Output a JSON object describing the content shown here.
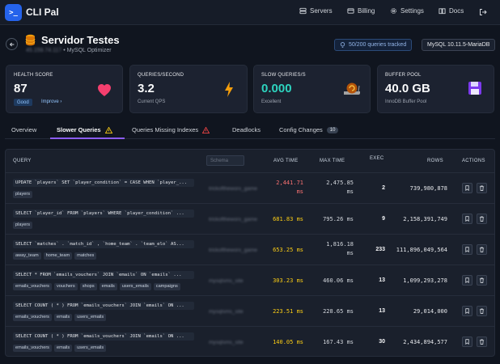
{
  "app": {
    "name": "CLI Pal"
  },
  "nav": [
    {
      "label": "Servers",
      "icon": "server-icon"
    },
    {
      "label": "Billing",
      "icon": "billing-icon"
    },
    {
      "label": "Settings",
      "icon": "gear-icon"
    },
    {
      "label": "Docs",
      "icon": "book-icon"
    }
  ],
  "server": {
    "title": "Servidor Testes",
    "ip": "45.159.74.117",
    "subtitle": "• MySQL Optimizer",
    "queries_tracked": "50/200 queries tracked",
    "version": "MySQL 10.11.5-MariaDB"
  },
  "cards": [
    {
      "label": "HEALTH SCORE",
      "value": "87",
      "badge": "Good",
      "link": "Improve ›",
      "icon": "heart-icon"
    },
    {
      "label": "QUERIES/SECOND",
      "value": "3.2",
      "sub": "Current QPS",
      "icon": "lightning-icon"
    },
    {
      "label": "SLOW QUERIES/S",
      "value": "0.000",
      "sub": "Excellent",
      "icon": "snail-icon",
      "value_color": "#2dd4bf"
    },
    {
      "label": "BUFFER POOL",
      "value": "40.0 GB",
      "sub": "InnoDB Buffer Pool",
      "icon": "floppy-disk-icon"
    }
  ],
  "tabs": [
    {
      "label": "Overview"
    },
    {
      "label": "Slower Queries",
      "warning": true
    },
    {
      "label": "Queries Missing Indexes",
      "warning": true
    },
    {
      "label": "Deadlocks"
    },
    {
      "label": "Config Changes",
      "count": "10"
    }
  ],
  "table": {
    "headers": {
      "query": "QUERY",
      "schema_placeholder": "Schema",
      "avg": "AVG TIME",
      "max": "MAX TIME",
      "exec": "EXEC",
      "rows": "ROWS",
      "actions": "ACTIONS"
    },
    "rows": [
      {
        "sql": "UPDATE `players` SET `player_condition` = CASE WHEN `player_...",
        "tags": [
          "players"
        ],
        "schema": "trickoftheworx_game",
        "avg": "2,441.71",
        "avg_unit": "ms",
        "max": "2,475.85",
        "max_unit": "ms",
        "exec": "2",
        "rows": "739,980,878",
        "avg_color": "#f87171"
      },
      {
        "sql": "SELECT `player_id` FROM `players` WHERE `player_condition` ...",
        "tags": [
          "players"
        ],
        "schema": "trickoftheworx_game",
        "avg": "681.83 ms",
        "max": "795.26 ms",
        "exec": "9",
        "rows": "2,158,391,749",
        "avg_color": "#facc15"
      },
      {
        "sql": "SELECT `matches` . `match_id` , `home_team` . `team_elo` AS...",
        "tags": [
          "away_team",
          "home_team",
          "matches"
        ],
        "schema": "trickoftheworx_game",
        "avg": "653.25 ms",
        "max": "1,816.18",
        "max_unit": "ms",
        "exec": "233",
        "rows": "111,896,049,564",
        "avg_color": "#facc15"
      },
      {
        "sql": "SELECT * FROM `emails_vouchers` JOIN `emails` ON `emails` ...",
        "tags": [
          "emails_vouchers",
          "vouchers",
          "shops",
          "emails",
          "users_emails",
          "campaigns"
        ],
        "schema": "mysqlsms_site",
        "avg": "303.23 ms",
        "max": "460.06 ms",
        "exec": "13",
        "rows": "1,099,293,278",
        "avg_color": "#facc15"
      },
      {
        "sql": "SELECT COUNT ( * ) FROM `emails_vouchers` JOIN `emails` ON ...",
        "tags": [
          "emails_vouchers",
          "emails",
          "users_emails"
        ],
        "schema": "mysqlsms_site",
        "avg": "223.51 ms",
        "max": "228.65 ms",
        "exec": "13",
        "rows": "29,014,000",
        "avg_color": "#facc15"
      },
      {
        "sql": "SELECT COUNT ( * ) FROM `emails_vouchers` JOIN `emails` ON ...",
        "tags": [
          "emails_vouchers",
          "emails",
          "users_emails"
        ],
        "schema": "mysqlsms_site",
        "avg": "140.05 ms",
        "max": "167.43 ms",
        "exec": "30",
        "rows": "2,434,894,577",
        "avg_color": "#facc15"
      }
    ]
  }
}
